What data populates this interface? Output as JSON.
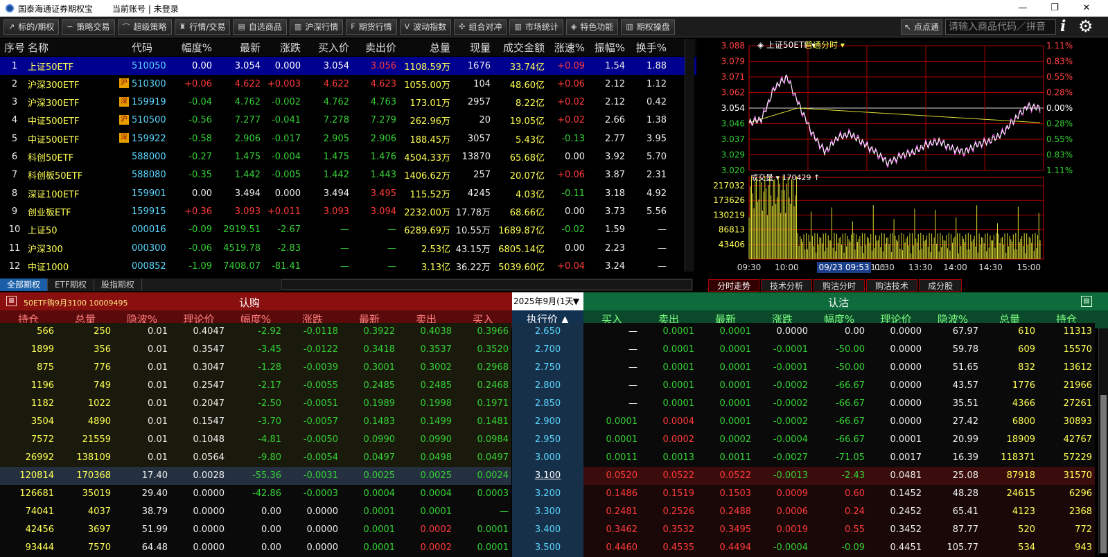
{
  "app": {
    "title": "国泰海通证券期权宝",
    "account": "当前账号 | 未登录",
    "win_min": "—",
    "win_max": "❐",
    "win_close": "✕"
  },
  "toolbar": {
    "items": [
      "标的/期权",
      "策略交易",
      "超级策略",
      "行情/交易",
      "自选商品",
      "沪深行情",
      "期货行情",
      "波动指数",
      "组合对冲",
      "市场统计",
      "特色功能",
      "期权操盘"
    ],
    "point": "点点通",
    "search_placeholder": "请输入商品代码／拼音"
  },
  "quote_table": {
    "headers": [
      "序号",
      "名称",
      "代码",
      "幅度%",
      "最新",
      "涨跌",
      "买入价",
      "卖出价",
      "总量",
      "现量",
      "成交金额",
      "涨速%",
      "振幅%",
      "换手%"
    ],
    "rows": [
      {
        "no": "1",
        "name": "上证50ETF",
        "code": "510050",
        "pct": "0.00",
        "last": "3.054",
        "chg": "0.000",
        "bid": "3.054",
        "ask": "3.056",
        "vol": "1108.59万",
        "cur": "1676",
        "amt": "33.74亿",
        "speed": "+0.09",
        "amp": "1.54",
        "turn": "1.88",
        "badge": ""
      },
      {
        "no": "2",
        "name": "沪深300ETF",
        "code": "510300",
        "pct": "+0.06",
        "last": "4.622",
        "chg": "+0.003",
        "bid": "4.622",
        "ask": "4.623",
        "vol": "1055.00万",
        "cur": "104",
        "amt": "48.60亿",
        "speed": "+0.06",
        "amp": "2.12",
        "turn": "1.12",
        "badge": "沪"
      },
      {
        "no": "3",
        "name": "沪深300ETF",
        "code": "159919",
        "pct": "-0.04",
        "last": "4.762",
        "chg": "-0.002",
        "bid": "4.762",
        "ask": "4.763",
        "vol": "173.01万",
        "cur": "2957",
        "amt": "8.22亿",
        "speed": "+0.02",
        "amp": "2.12",
        "turn": "0.42",
        "badge": "深"
      },
      {
        "no": "4",
        "name": "中证500ETF",
        "code": "510500",
        "pct": "-0.56",
        "last": "7.277",
        "chg": "-0.041",
        "bid": "7.278",
        "ask": "7.279",
        "vol": "262.96万",
        "cur": "20",
        "amt": "19.05亿",
        "speed": "+0.02",
        "amp": "2.66",
        "turn": "1.38",
        "badge": "沪"
      },
      {
        "no": "5",
        "name": "中证500ETF",
        "code": "159922",
        "pct": "-0.58",
        "last": "2.906",
        "chg": "-0.017",
        "bid": "2.905",
        "ask": "2.906",
        "vol": "188.45万",
        "cur": "3057",
        "amt": "5.43亿",
        "speed": "-0.13",
        "amp": "2.77",
        "turn": "3.95",
        "badge": "深"
      },
      {
        "no": "6",
        "name": "科创50ETF",
        "code": "588000",
        "pct": "-0.27",
        "last": "1.475",
        "chg": "-0.004",
        "bid": "1.475",
        "ask": "1.476",
        "vol": "4504.33万",
        "cur": "13870",
        "amt": "65.68亿",
        "speed": "0.00",
        "amp": "3.92",
        "turn": "5.70",
        "badge": ""
      },
      {
        "no": "7",
        "name": "科创板50ETF",
        "code": "588080",
        "pct": "-0.35",
        "last": "1.442",
        "chg": "-0.005",
        "bid": "1.442",
        "ask": "1.443",
        "vol": "1406.62万",
        "cur": "257",
        "amt": "20.07亿",
        "speed": "+0.06",
        "amp": "3.87",
        "turn": "2.31",
        "badge": ""
      },
      {
        "no": "8",
        "name": "深证100ETF",
        "code": "159901",
        "pct": "0.00",
        "last": "3.494",
        "chg": "0.000",
        "bid": "3.494",
        "ask": "3.495",
        "vol": "115.52万",
        "cur": "4245",
        "amt": "4.03亿",
        "speed": "-0.11",
        "amp": "3.18",
        "turn": "4.92",
        "badge": ""
      },
      {
        "no": "9",
        "name": "创业板ETF",
        "code": "159915",
        "pct": "+0.36",
        "last": "3.093",
        "chg": "+0.011",
        "bid": "3.093",
        "ask": "3.094",
        "vol": "2232.00万",
        "cur": "17.78万",
        "amt": "68.66亿",
        "speed": "0.00",
        "amp": "3.73",
        "turn": "5.56",
        "badge": ""
      },
      {
        "no": "10",
        "name": "上证50",
        "code": "000016",
        "pct": "-0.09",
        "last": "2919.51",
        "chg": "-2.67",
        "bid": "—",
        "ask": "—",
        "vol": "6289.69万",
        "cur": "10.55万",
        "amt": "1689.87亿",
        "speed": "-0.02",
        "amp": "1.59",
        "turn": "—",
        "badge": ""
      },
      {
        "no": "11",
        "name": "沪深300",
        "code": "000300",
        "pct": "-0.06",
        "last": "4519.78",
        "chg": "-2.83",
        "bid": "—",
        "ask": "—",
        "vol": "2.53亿",
        "cur": "43.15万",
        "amt": "6805.14亿",
        "speed": "0.00",
        "amp": "2.23",
        "turn": "—",
        "badge": ""
      },
      {
        "no": "12",
        "name": "中证1000",
        "code": "000852",
        "pct": "-1.09",
        "last": "7408.07",
        "chg": "-81.41",
        "bid": "—",
        "ask": "—",
        "vol": "3.13亿",
        "cur": "36.22万",
        "amt": "5039.60亿",
        "speed": "+0.04",
        "amp": "3.24",
        "turn": "—",
        "badge": ""
      }
    ]
  },
  "filter_tabs": [
    "全部期权",
    "ETF期权",
    "股指期权"
  ],
  "chart": {
    "symbol": "上证50ETF",
    "mode": "普通分时",
    "price_ticks": [
      "3.088",
      "3.079",
      "3.071",
      "3.062",
      "3.054",
      "3.046",
      "3.037",
      "3.029",
      "3.020"
    ],
    "pct_ticks": [
      "1.11%",
      "0.83%",
      "0.55%",
      "0.28%",
      "0.00%",
      "0.28%",
      "0.55%",
      "0.83%",
      "1.11%"
    ],
    "volume_label": "成交量",
    "volume_value": "170429",
    "vol_ticks": [
      "217032",
      "173626",
      "130219",
      "86813",
      "43406"
    ],
    "time_ticks": [
      "09:30",
      "10:00",
      "11:30",
      "13:30",
      "14:00",
      "14:30",
      "15:00"
    ],
    "time_cursor": "09/23 09:53",
    "time_partial": ":00",
    "tabs": [
      "分时走势",
      "技术分析",
      "购沽分时",
      "购沽技术",
      "成分股"
    ]
  },
  "chart_data": {
    "type": "line",
    "series": [],
    "x": [
      "09:30",
      "10:00",
      "11:30",
      "13:30",
      "14:00",
      "14:30",
      "15:00"
    ],
    "ylim": [
      3.02,
      3.088
    ]
  },
  "options": {
    "call_title": "认购",
    "put_title": "认沽",
    "contract": "50ETF购9月3100  10009495",
    "expiry": "2025年9月(1天",
    "call_headers": [
      "持仓",
      "总量",
      "隐波%",
      "理论价",
      "幅度%",
      "涨跌",
      "最新",
      "卖出",
      "买入"
    ],
    "strike_header": "执行价 ▲",
    "put_headers": [
      "买入",
      "卖出",
      "最新",
      "涨跌",
      "幅度%",
      "理论价",
      "隐波%",
      "总量",
      "持仓"
    ],
    "rows": [
      {
        "c": [
          "566",
          "250",
          "0.01",
          "0.4047",
          "-2.92",
          "-0.0118",
          "0.3922",
          "0.4038",
          "0.3966"
        ],
        "k": "2.650",
        "p": [
          "—",
          "0.0001",
          "0.0001",
          "0.0000",
          "0.00",
          "0.0000",
          "67.97",
          "610",
          "11313"
        ]
      },
      {
        "c": [
          "1899",
          "356",
          "0.01",
          "0.3547",
          "-3.45",
          "-0.0122",
          "0.3418",
          "0.3537",
          "0.3520"
        ],
        "k": "2.700",
        "p": [
          "—",
          "0.0001",
          "0.0001",
          "-0.0001",
          "-50.00",
          "0.0000",
          "59.78",
          "609",
          "15570"
        ]
      },
      {
        "c": [
          "875",
          "776",
          "0.01",
          "0.3047",
          "-1.28",
          "-0.0039",
          "0.3001",
          "0.3002",
          "0.2968"
        ],
        "k": "2.750",
        "p": [
          "—",
          "0.0001",
          "0.0001",
          "-0.0001",
          "-50.00",
          "0.0000",
          "51.65",
          "832",
          "13612"
        ]
      },
      {
        "c": [
          "1196",
          "749",
          "0.01",
          "0.2547",
          "-2.17",
          "-0.0055",
          "0.2485",
          "0.2485",
          "0.2468"
        ],
        "k": "2.800",
        "p": [
          "—",
          "0.0001",
          "0.0001",
          "-0.0002",
          "-66.67",
          "0.0000",
          "43.57",
          "1776",
          "21966"
        ]
      },
      {
        "c": [
          "1182",
          "1022",
          "0.01",
          "0.2047",
          "-2.50",
          "-0.0051",
          "0.1989",
          "0.1998",
          "0.1971"
        ],
        "k": "2.850",
        "p": [
          "—",
          "0.0001",
          "0.0001",
          "-0.0002",
          "-66.67",
          "0.0000",
          "35.51",
          "4366",
          "27261"
        ]
      },
      {
        "c": [
          "3504",
          "4890",
          "0.01",
          "0.1547",
          "-3.70",
          "-0.0057",
          "0.1483",
          "0.1499",
          "0.1481"
        ],
        "k": "2.900",
        "p": [
          "0.0001",
          "0.0004",
          "0.0001",
          "-0.0002",
          "-66.67",
          "0.0000",
          "27.42",
          "6800",
          "30893"
        ]
      },
      {
        "c": [
          "7572",
          "21559",
          "0.01",
          "0.1048",
          "-4.81",
          "-0.0050",
          "0.0990",
          "0.0990",
          "0.0984"
        ],
        "k": "2.950",
        "p": [
          "0.0001",
          "0.0002",
          "0.0002",
          "-0.0004",
          "-66.67",
          "0.0001",
          "20.99",
          "18909",
          "42767"
        ]
      },
      {
        "c": [
          "26992",
          "138109",
          "0.01",
          "0.0564",
          "-9.80",
          "-0.0054",
          "0.0497",
          "0.0498",
          "0.0497"
        ],
        "k": "3.000",
        "p": [
          "0.0011",
          "0.0013",
          "0.0011",
          "-0.0027",
          "-71.05",
          "0.0017",
          "16.39",
          "118371",
          "57229"
        ]
      },
      {
        "c": [
          "120814",
          "170368",
          "17.40",
          "0.0028",
          "-55.36",
          "-0.0031",
          "0.0025",
          "0.0025",
          "0.0024"
        ],
        "k": "3.100",
        "p": [
          "0.0520",
          "0.0522",
          "0.0522",
          "-0.0013",
          "-2.43",
          "0.0481",
          "25.08",
          "87918",
          "31570"
        ]
      },
      {
        "c": [
          "126681",
          "35019",
          "29.40",
          "0.0000",
          "-42.86",
          "-0.0003",
          "0.0004",
          "0.0004",
          "0.0003"
        ],
        "k": "3.200",
        "p": [
          "0.1486",
          "0.1519",
          "0.1503",
          "0.0009",
          "0.60",
          "0.1452",
          "48.28",
          "24615",
          "6296"
        ]
      },
      {
        "c": [
          "74041",
          "4037",
          "38.79",
          "0.0000",
          "0.00",
          "0.0000",
          "0.0001",
          "0.0001",
          "—"
        ],
        "k": "3.300",
        "p": [
          "0.2481",
          "0.2526",
          "0.2488",
          "0.0006",
          "0.24",
          "0.2452",
          "65.41",
          "4123",
          "2368"
        ]
      },
      {
        "c": [
          "42456",
          "3697",
          "51.99",
          "0.0000",
          "0.00",
          "0.0000",
          "0.0001",
          "0.0002",
          "0.0001"
        ],
        "k": "3.400",
        "p": [
          "0.3462",
          "0.3532",
          "0.3495",
          "0.0019",
          "0.55",
          "0.3452",
          "87.77",
          "520",
          "772"
        ]
      },
      {
        "c": [
          "93444",
          "7570",
          "64.48",
          "0.0000",
          "0.00",
          "0.0000",
          "0.0001",
          "0.0002",
          "0.0001"
        ],
        "k": "3.500",
        "p": [
          "0.4460",
          "0.4535",
          "0.4494",
          "-0.0004",
          "-0.09",
          "0.4451",
          "105.77",
          "534",
          "943"
        ]
      }
    ]
  },
  "colors": {
    "up": "#ff3a3a",
    "down": "#35d035",
    "name": "#ffff55",
    "code": "#5ad7ff",
    "call_bg": "#8a1010",
    "put_bg": "#0e6b3c"
  }
}
